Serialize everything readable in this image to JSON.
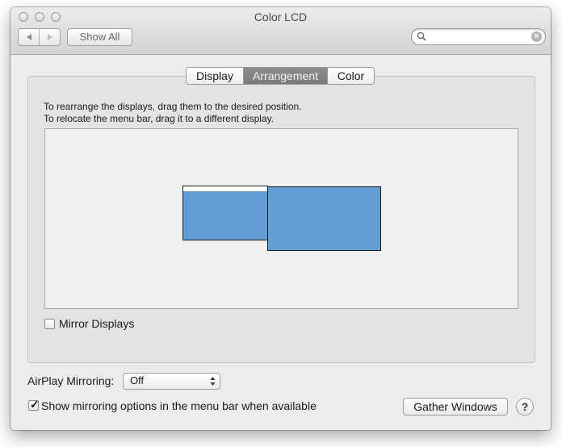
{
  "window": {
    "title": "Color LCD"
  },
  "toolbar": {
    "show_all_label": "Show All",
    "back_icon": "triangle-left",
    "forward_icon": "triangle-right"
  },
  "search": {
    "placeholder": "",
    "value": ""
  },
  "tabs": [
    {
      "label": "Display",
      "active": false
    },
    {
      "label": "Arrangement",
      "active": true
    },
    {
      "label": "Color",
      "active": false
    }
  ],
  "arrangement": {
    "instruction_line1": "To rearrange the displays, drag them to the desired position.",
    "instruction_line2": "To relocate the menu bar, drag it to a different display.",
    "display_color": "#629dd4",
    "displays": [
      {
        "name": "display-1",
        "has_menu_bar": true
      },
      {
        "name": "display-2",
        "has_menu_bar": false
      }
    ]
  },
  "mirror_displays": {
    "label": "Mirror Displays",
    "checked": false
  },
  "airplay": {
    "label": "AirPlay Mirroring:",
    "value": "Off"
  },
  "show_mirroring": {
    "label": "Show mirroring options in the menu bar when available",
    "checked": true
  },
  "gather_windows_label": "Gather Windows",
  "help_label": "?"
}
